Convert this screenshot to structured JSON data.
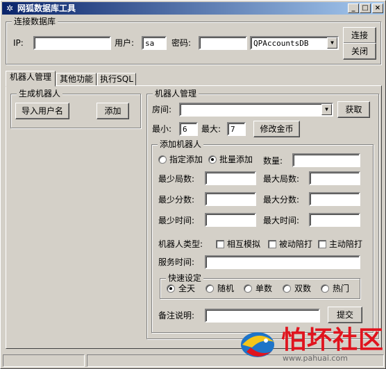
{
  "window": {
    "title": "网狐数据库工具",
    "icon": "app-gear-icon"
  },
  "connect": {
    "legend": "连接数据库",
    "ip_label": "IP:",
    "ip_value": "",
    "user_label": "用户:",
    "user_value": "sa",
    "pwd_label": "密码:",
    "pwd_value": "",
    "db_value": "QPAccountsDB",
    "connect_btn": "连接",
    "close_btn": "关闭"
  },
  "tabs": [
    {
      "label": "机器人管理",
      "active": true
    },
    {
      "label": "其他功能"
    },
    {
      "label": "执行SQL"
    }
  ],
  "gen": {
    "legend": "生成机器人",
    "import_btn": "导入用户名",
    "add_btn": "添加"
  },
  "mgr": {
    "legend": "机器人管理",
    "room_label": "房间:",
    "room_value": "",
    "fetch_btn": "获取",
    "min_label": "最小:",
    "min_value": "6",
    "max_label": "最大:",
    "max_value": "7",
    "modify_btn": "修改金币"
  },
  "addbot": {
    "legend": "添加机器人",
    "mode_single": "指定添加",
    "mode_batch": "批量添加",
    "count_label": "数量:",
    "min_games": "最少局数:",
    "max_games": "最大局数:",
    "min_score": "最少分数:",
    "max_score": "最大分数:",
    "min_time": "最少时间:",
    "max_time": "最大时间:",
    "type_label": "机器人类型:",
    "type_mutual": "相互模拟",
    "type_passive": "被动陪打",
    "type_active": "主动陪打",
    "service_label": "服务时间:"
  },
  "quick": {
    "legend": "快速设定",
    "opts": [
      "全天",
      "随机",
      "单数",
      "双数",
      "热门"
    ]
  },
  "note": {
    "label": "备注说明:",
    "submit_btn": "提交"
  },
  "watermark": {
    "text": "怕坏社区",
    "url": "www.pahuai.com"
  },
  "colors": {
    "title_start": "#0a246a",
    "title_end": "#a6caf0",
    "watermark": "#e0141e"
  }
}
